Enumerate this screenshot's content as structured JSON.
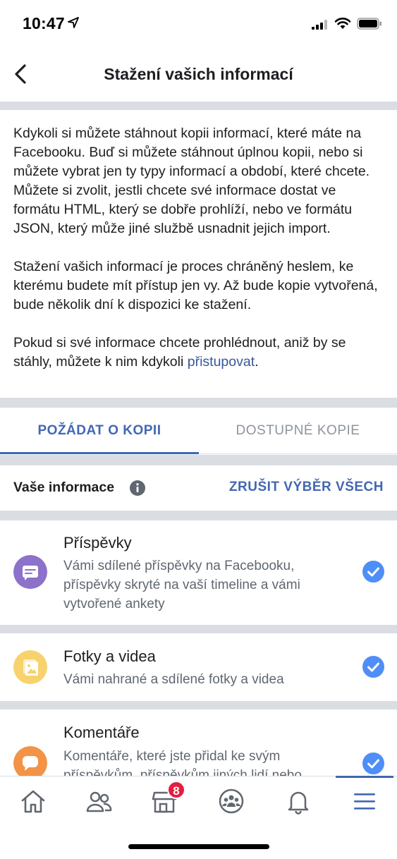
{
  "status_bar": {
    "time": "10:47"
  },
  "header": {
    "title": "Stažení vašich informací"
  },
  "intro": {
    "paragraph1": "Kdykoli si můžete stáhnout kopii informací, které máte na Facebooku. Buď si můžete stáhnout úplnou kopii, nebo si můžete vybrat jen ty typy informací a období, které chcete. Můžete si zvolit, jestli chcete své informace dostat ve formátu HTML, který se dobře prohlíží, nebo ve formátu JSON, který může jiné službě usnadnit jejich import.",
    "paragraph2": "Stažení vašich informací je proces chráněný heslem, ke kterému budete mít přístup jen vy. Až bude kopie vytvořená, bude několik dní k dispozici ke stažení.",
    "paragraph3_prefix": "Pokud si své informace chcete prohlédnout, aniž by se stáhly, můžete k nim kdykoli ",
    "paragraph3_link": "přistupovat",
    "paragraph3_suffix": "."
  },
  "tabs": {
    "request_copy": "POŽÁDAT O KOPII",
    "available_copies": "DOSTUPNÉ KOPIE"
  },
  "section": {
    "label": "Vaše informace",
    "deselect_all": "ZRUŠIT VÝBĚR VŠECH"
  },
  "items": [
    {
      "title": "Příspěvky",
      "description": "Vámi sdílené příspěvky na Facebooku, příspěvky skryté na vaší timeline a vámi vytvořené ankety",
      "icon": "posts-icon",
      "color": "#8c72cb",
      "checked": true
    },
    {
      "title": "Fotky a videa",
      "description": "Vámi nahrané a sdílené fotky a videa",
      "icon": "photos-icon",
      "color": "#f7d26d",
      "checked": true
    },
    {
      "title": "Komentáře",
      "description": "Komentáře, které jste přidal ke svým příspěvkům, příspěvkům jiných lidí nebo",
      "icon": "comments-icon",
      "color": "#f29347",
      "checked": true
    }
  ],
  "bottom_nav": {
    "marketplace_badge": "8"
  },
  "colors": {
    "accent": "#4267b2",
    "divider": "#dadde1",
    "badge": "#e41e3f"
  }
}
